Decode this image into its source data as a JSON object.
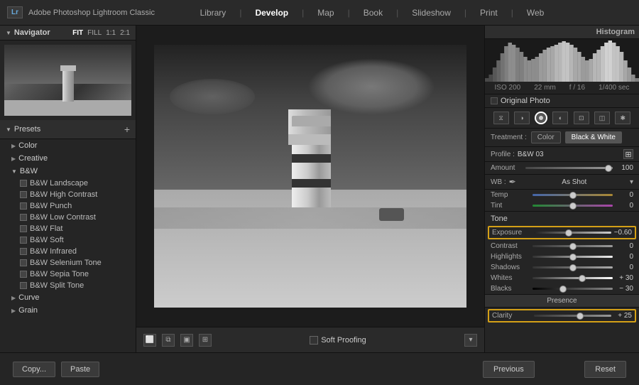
{
  "app": {
    "name": "Adobe Photoshop",
    "full_name": "Adobe Photoshop Lightroom Classic",
    "logo": "Lr"
  },
  "top_nav": {
    "items": [
      "Library",
      "Develop",
      "Map",
      "Book",
      "Slideshow",
      "Print",
      "Web"
    ],
    "active": "Develop"
  },
  "navigator": {
    "title": "Navigator",
    "zoom_options": [
      "FIT",
      "FILL",
      "1:1",
      "2:1"
    ]
  },
  "presets": {
    "title": "Presets",
    "groups": [
      {
        "name": "Color",
        "expanded": false
      },
      {
        "name": "Creative",
        "expanded": false
      },
      {
        "name": "B&W",
        "expanded": true,
        "items": [
          "B&W Landscape",
          "B&W High Contrast",
          "B&W Punch",
          "B&W Low Contrast",
          "B&W Flat",
          "B&W Soft",
          "B&W Infrared",
          "B&W Selenium Tone",
          "B&W Sepia Tone",
          "B&W Split Tone"
        ]
      },
      {
        "name": "Curve",
        "expanded": false
      },
      {
        "name": "Grain",
        "expanded": false
      }
    ]
  },
  "bottom_left": {
    "copy_label": "Copy...",
    "paste_label": "Paste"
  },
  "toolbar": {
    "soft_proofing_label": "Soft Proofing"
  },
  "histogram": {
    "title": "Histogram"
  },
  "camera_info": {
    "iso": "ISO 200",
    "focal": "22 mm",
    "aperture": "f / 16",
    "shutter": "1/400 sec"
  },
  "original_photo": {
    "label": "Original Photo"
  },
  "treatment": {
    "label": "Treatment :",
    "color_label": "Color",
    "bw_label": "Black & White",
    "active": "Black & White"
  },
  "profile": {
    "label": "Profile :",
    "value": "B&W 03"
  },
  "amount": {
    "label": "Amount",
    "value": "100",
    "thumb_pos": "95%"
  },
  "wb": {
    "label": "WB :",
    "value": "As Shot"
  },
  "tone": {
    "label": "Tone"
  },
  "sliders": {
    "temp": {
      "label": "Temp",
      "value": "0",
      "thumb": "50%"
    },
    "tint": {
      "label": "Tint",
      "value": "0",
      "thumb": "50%"
    },
    "exposure": {
      "label": "Exposure",
      "value": "−0.60",
      "thumb": "45%",
      "highlighted": true
    },
    "contrast": {
      "label": "Contrast",
      "value": "0",
      "thumb": "50%"
    },
    "highlights": {
      "label": "Highlights",
      "value": "0",
      "thumb": "50%"
    },
    "shadows": {
      "label": "Shadows",
      "value": "0",
      "thumb": "50%"
    },
    "whites": {
      "label": "Whites",
      "value": "+ 30",
      "thumb": "62%"
    },
    "blacks": {
      "label": "Blacks",
      "value": "− 30",
      "thumb": "38%"
    },
    "clarity": {
      "label": "Clarity",
      "value": "+ 25",
      "thumb": "60%",
      "highlighted": true
    }
  },
  "presence": {
    "title": "Presence"
  },
  "bottom_right": {
    "previous_label": "Previous",
    "reset_label": "Reset"
  }
}
